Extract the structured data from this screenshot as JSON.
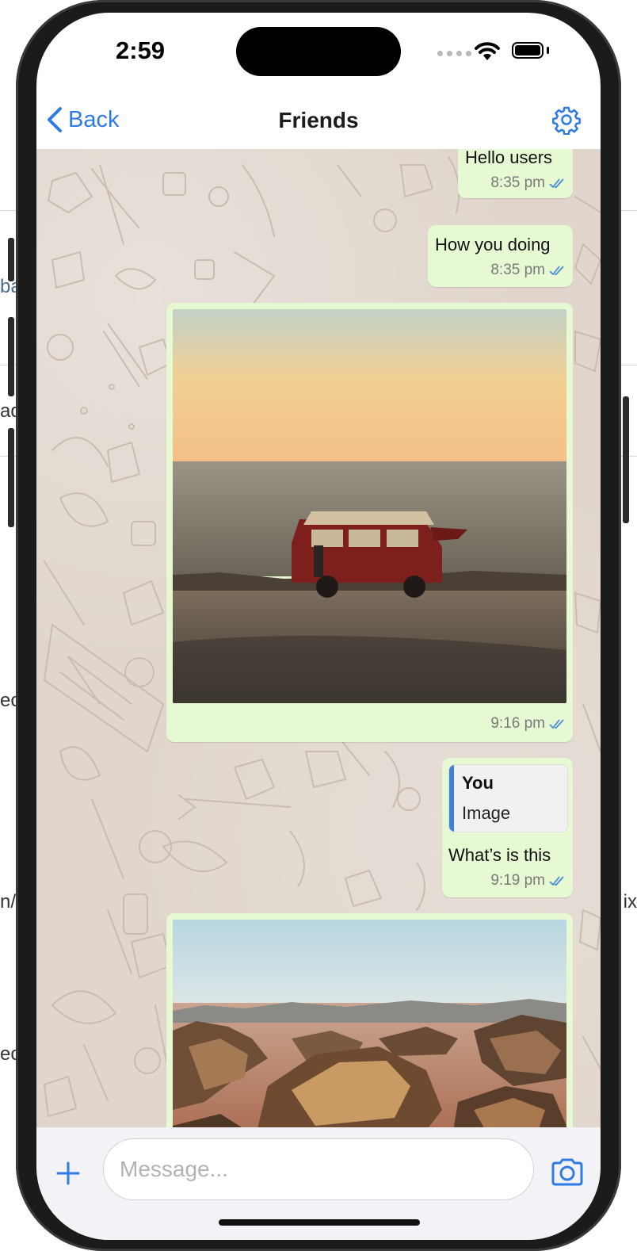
{
  "status_bar": {
    "time": "2:59"
  },
  "nav": {
    "back_label": "Back",
    "title": "Friends"
  },
  "messages": [
    {
      "text": "Hello users",
      "time": "8:35 pm"
    },
    {
      "text": "How you doing",
      "time": "8:35 pm"
    },
    {
      "image": "van-at-sunset-photo",
      "time": "9:16 pm"
    },
    {
      "reply_author": "You",
      "reply_text": "Image",
      "text": "What’s is this",
      "time": "9:19 pm"
    },
    {
      "image": "desert-rocks-photo"
    }
  ],
  "input": {
    "placeholder": "Message..."
  },
  "icons": {
    "back": "chevron-left-icon",
    "settings": "gear-icon",
    "add": "plus-icon",
    "camera": "camera-icon",
    "read": "double-check-icon"
  },
  "colors": {
    "accent": "#2f7be5",
    "bubble": "#e6f9d2",
    "chat_bg": "#e0d6cd",
    "read_ticks": "#4a90d9"
  },
  "background_fragments": [
    "ba",
    "ad",
    "ec",
    "n/",
    "ix",
    "ec"
  ]
}
